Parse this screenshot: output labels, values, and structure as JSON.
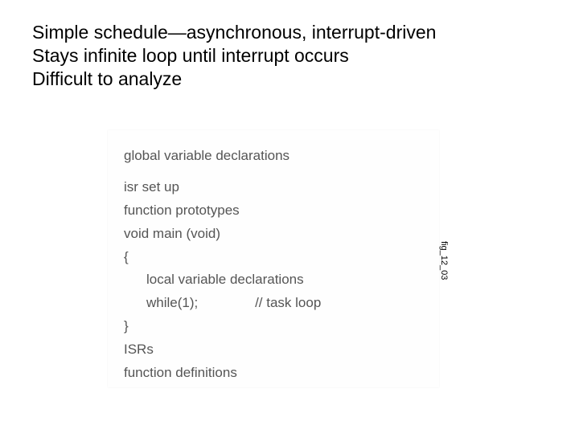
{
  "title": {
    "line1": "Simple schedule—asynchronous, interrupt-driven",
    "line2": "Stays infinite loop until interrupt occurs",
    "line3": "Difficult to analyze"
  },
  "code": {
    "l1": "global variable declarations",
    "l2": "isr set up",
    "l3": "function prototypes",
    "l4": "void main (void)",
    "l5": "{",
    "l6": "local variable declarations",
    "l7": "while(1);               // task loop",
    "l8": "}",
    "l9": "ISRs",
    "l10": "function definitions"
  },
  "side_label": "fig_12_03"
}
